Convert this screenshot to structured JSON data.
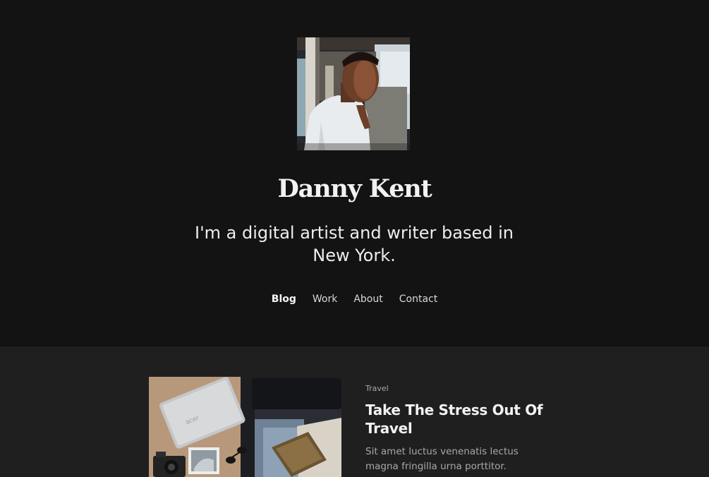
{
  "site": {
    "title": "Danny Kent",
    "tagline": "I'm a digital artist and writer based in New York."
  },
  "nav": {
    "items": [
      {
        "label": "Blog",
        "active": true
      },
      {
        "label": "Work",
        "active": false
      },
      {
        "label": "About",
        "active": false
      },
      {
        "label": "Contact",
        "active": false
      }
    ]
  },
  "posts": [
    {
      "category": "Travel",
      "title": "Take The Stress Out Of Travel",
      "excerpt": "Sit amet luctus venenatis lectus magna fringilla urna porttitor."
    }
  ],
  "colors": {
    "hero_background": "#141314",
    "posts_background": "#1f1f20",
    "text_primary": "#f2f2f2",
    "text_muted": "#a8a8a8"
  }
}
